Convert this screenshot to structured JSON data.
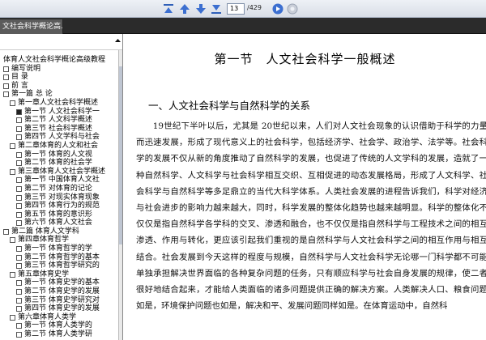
{
  "toolbar": {
    "current_page": "13",
    "total_pages": "/429",
    "buttons": [
      "first-page-icon",
      "prev-page-icon",
      "next-page-icon",
      "last-page-icon",
      "go-icon",
      "zoom-icon"
    ]
  },
  "tab": {
    "title": "文社会科学概论高..."
  },
  "sidebar": {
    "items": [
      {
        "label": "体育人文社会科学概论高级教程",
        "level": 0,
        "box": false
      },
      {
        "label": "编写说明",
        "level": 0,
        "box": true
      },
      {
        "label": "目    录",
        "level": 0,
        "box": true
      },
      {
        "label": "前    言",
        "level": 0,
        "box": true
      },
      {
        "label": "第一篇    总    论",
        "level": 0,
        "box": true
      },
      {
        "label": "第一章人文社会科学概述",
        "level": 1,
        "box": true
      },
      {
        "label": "第一节    人文社会科学一",
        "level": 2,
        "box": true
      },
      {
        "label": "第二节    人文科学概述",
        "level": 2,
        "box": true
      },
      {
        "label": "第三节    社会科学概述",
        "level": 2,
        "box": true
      },
      {
        "label": "第四节    人文学科与社会",
        "level": 2,
        "box": true
      },
      {
        "label": "第二章体育的人文和社会",
        "level": 1,
        "box": true
      },
      {
        "label": "第一节    体育的人文视",
        "level": 2,
        "box": true
      },
      {
        "label": "第二节    体育的社会学",
        "level": 2,
        "box": true
      },
      {
        "label": "第三章体育人文社会学概述",
        "level": 1,
        "box": true
      },
      {
        "label": "第一节    中国体育人文社",
        "level": 2,
        "box": true
      },
      {
        "label": "第二节    对体育的记论",
        "level": 2,
        "box": true
      },
      {
        "label": "第三节    对现实体育现象",
        "level": 2,
        "box": true
      },
      {
        "label": "第四节    体育行为的规范",
        "level": 2,
        "box": true
      },
      {
        "label": "第五节    体育的意识形",
        "level": 2,
        "box": true
      },
      {
        "label": "第六节    体育人文社会",
        "level": 2,
        "box": true
      },
      {
        "label": "第二篇    体育人文学科",
        "level": 0,
        "box": true
      },
      {
        "label": "第四章体育哲学",
        "level": 1,
        "box": true
      },
      {
        "label": "第一节    体育哲学的学",
        "level": 2,
        "box": true
      },
      {
        "label": "第二节    体育哲学的基本",
        "level": 2,
        "box": true
      },
      {
        "label": "第三节    体育哲学研究的",
        "level": 2,
        "box": true
      },
      {
        "label": "第五章体育史学",
        "level": 1,
        "box": true
      },
      {
        "label": "第一节    体育史学的基本",
        "level": 2,
        "box": true
      },
      {
        "label": "第二节    体育史学的发展",
        "level": 2,
        "box": true
      },
      {
        "label": "第三节    体育史学研究对",
        "level": 2,
        "box": true
      },
      {
        "label": "第四节    体育史学的发展",
        "level": 2,
        "box": true
      },
      {
        "label": "第六章体育人类学",
        "level": 1,
        "box": true
      },
      {
        "label": "第一节    体育人类学的",
        "level": 2,
        "box": true
      },
      {
        "label": "第二节    体育人类学研",
        "level": 2,
        "box": true
      }
    ]
  },
  "document": {
    "chapter_num": "第一节",
    "chapter_title": "人文社会科学一般概述",
    "section": "一、人文社会科学与自然科学的关系",
    "body": "19世纪下半叶以后，尤其是 20世纪以来，人们对人文社会现象的认识借助于科学的力量而迅速发展，形成了现代意义上的社会科学，包括经济学、社会学、政治学、法学等。社会科学的发展不仅从新的角度推动了自然科学的发展，也促进了传统的人文学科的发展，造就了一种自然科学、人文科学与社会科学相互交织、互相促进的动态发展格局，形成了人文科学、社会科学与自然科学等多足鼎立的当代大科学体系。人类社会发展的进程告诉我们，科学对经济与社会进步的影响力越来越大，同时，科学发展的整体化趋势也越来越明显。科学的整体化不仅仅是指自然科学各学科的交叉、渗透和融合，也不仅仅是指自然科学与工程技术之间的相互渗透、作用与转化，更应该引起我们重视的是自然科学与人文社会科学之间的相互作用与相互结合。社会发展到今天这样的程度与规模，自然科学与人文社会科学无论哪一门科学都不可能单独承担解决世界面临的各种复杂问题的任务，只有顺应科学与社会自身发展的规律，使二者很好地结合起来，才能给人类面临的诸多问题提供正确的解决方案。人类解决人口、粮食问题如是，环境保护问题也如是，解决和平、发展问题同样如是。在体育运动中，自然科"
  }
}
